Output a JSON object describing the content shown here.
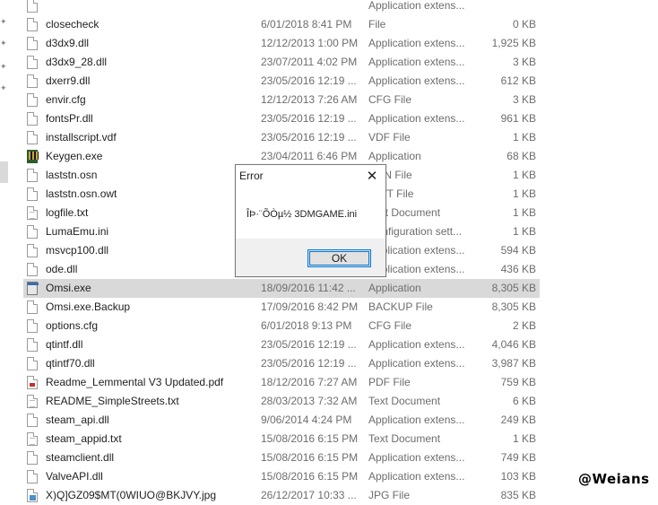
{
  "files": [
    {
      "name": "",
      "date": "",
      "type": "Application extens...",
      "size": "",
      "icon": "doc-icon"
    },
    {
      "name": "closecheck",
      "date": "6/01/2018 8:41 PM",
      "type": "File",
      "size": "0 KB",
      "icon": "doc-icon"
    },
    {
      "name": "d3dx9.dll",
      "date": "12/12/2013 1:00 PM",
      "type": "Application extens...",
      "size": "1,925 KB",
      "icon": "doc-icon"
    },
    {
      "name": "d3dx9_28.dll",
      "date": "23/07/2011 4:02 PM",
      "type": "Application extens...",
      "size": "3 KB",
      "icon": "doc-icon"
    },
    {
      "name": "dxerr9.dll",
      "date": "23/05/2016 12:19 ...",
      "type": "Application extens...",
      "size": "612 KB",
      "icon": "doc-icon"
    },
    {
      "name": "envir.cfg",
      "date": "12/12/2013 7:26 AM",
      "type": "CFG File",
      "size": "3 KB",
      "icon": "doc-icon"
    },
    {
      "name": "fontsPr.dll",
      "date": "23/05/2016 12:19 ...",
      "type": "Application extens...",
      "size": "961 KB",
      "icon": "doc-icon"
    },
    {
      "name": "installscript.vdf",
      "date": "23/05/2016 12:19 ...",
      "type": "VDF File",
      "size": "1 KB",
      "icon": "doc-icon"
    },
    {
      "name": "Keygen.exe",
      "date": "23/04/2011 6:46 PM",
      "type": "Application",
      "size": "68 KB",
      "icon": "keygen-app-icon"
    },
    {
      "name": "laststn.osn",
      "date": "",
      "type": "OSN File",
      "size": "1 KB",
      "icon": "doc-icon"
    },
    {
      "name": "laststn.osn.owt",
      "date": "",
      "type": "OWT File",
      "size": "1 KB",
      "icon": "doc-icon"
    },
    {
      "name": "logfile.txt",
      "date": "",
      "type": "Text Document",
      "size": "1 KB",
      "icon": "text-doc-icon"
    },
    {
      "name": "LumaEmu.ini",
      "date": "",
      "type": "Configuration sett...",
      "size": "1 KB",
      "icon": "doc-icon"
    },
    {
      "name": "msvcp100.dll",
      "date": "",
      "type": "Application extens...",
      "size": "594 KB",
      "icon": "doc-icon"
    },
    {
      "name": "ode.dll",
      "date": "",
      "type": "Application extens...",
      "size": "436 KB",
      "icon": "doc-icon"
    },
    {
      "name": "Omsi.exe",
      "date": "18/09/2016 11:42 ...",
      "type": "Application",
      "size": "8,305 KB",
      "icon": "exe-icon"
    },
    {
      "name": "Omsi.exe.Backup",
      "date": "17/09/2016 8:42 PM",
      "type": "BACKUP File",
      "size": "8,305 KB",
      "icon": "doc-icon"
    },
    {
      "name": "options.cfg",
      "date": "6/01/2018 9:13 PM",
      "type": "CFG File",
      "size": "2 KB",
      "icon": "doc-icon"
    },
    {
      "name": "qtintf.dll",
      "date": "23/05/2016 12:19 ...",
      "type": "Application extens...",
      "size": "4,046 KB",
      "icon": "doc-icon"
    },
    {
      "name": "qtintf70.dll",
      "date": "23/05/2016 12:19 ...",
      "type": "Application extens...",
      "size": "3,987 KB",
      "icon": "doc-icon"
    },
    {
      "name": "Readme_Lemmental V3 Updated.pdf",
      "date": "18/12/2016 7:27 AM",
      "type": "PDF File",
      "size": "759 KB",
      "icon": "pdf-icon"
    },
    {
      "name": "README_SimpleStreets.txt",
      "date": "28/03/2013 7:32 AM",
      "type": "Text Document",
      "size": "6 KB",
      "icon": "text-doc-icon"
    },
    {
      "name": "steam_api.dll",
      "date": "9/06/2014 4:24 PM",
      "type": "Application extens...",
      "size": "249 KB",
      "icon": "doc-icon"
    },
    {
      "name": "steam_appid.txt",
      "date": "15/08/2016 6:15 PM",
      "type": "Text Document",
      "size": "1 KB",
      "icon": "text-doc-icon"
    },
    {
      "name": "steamclient.dll",
      "date": "15/08/2016 6:15 PM",
      "type": "Application extens...",
      "size": "749 KB",
      "icon": "doc-icon"
    },
    {
      "name": "ValveAPI.dll",
      "date": "15/08/2016 6:15 PM",
      "type": "Application extens...",
      "size": "103 KB",
      "icon": "doc-icon"
    },
    {
      "name": "X)Q]GZ09$MT(0WIUO@BKJVY.jpg",
      "date": "26/12/2017 10:33 ...",
      "type": "JPG File",
      "size": "835 KB",
      "icon": "jpg-icon"
    }
  ],
  "selected_index": 15,
  "dialog": {
    "title": "Error",
    "message": "ÎÞ·¨ÕÒµ½ 3DMGAME.ini",
    "ok_label": "OK",
    "close_glyph": "✕"
  },
  "watermark": "@Weians",
  "colors": {
    "selection": "#d9d9d9",
    "accent": "#0078d7",
    "muted_text": "#6d6d6d"
  }
}
